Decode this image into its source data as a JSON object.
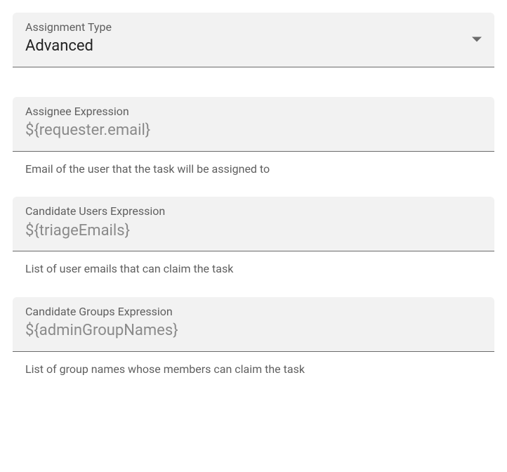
{
  "assignmentType": {
    "label": "Assignment Type",
    "value": "Advanced"
  },
  "assigneeExpression": {
    "label": "Assignee Expression",
    "value": "${requester.email}",
    "helper": "Email of the user that the task will be assigned to"
  },
  "candidateUsersExpression": {
    "label": "Candidate Users Expression",
    "value": "${triageEmails}",
    "helper": "List of user emails that can claim the task"
  },
  "candidateGroupsExpression": {
    "label": "Candidate Groups Expression",
    "value": "${adminGroupNames}",
    "helper": "List of group names whose members can claim the task"
  }
}
